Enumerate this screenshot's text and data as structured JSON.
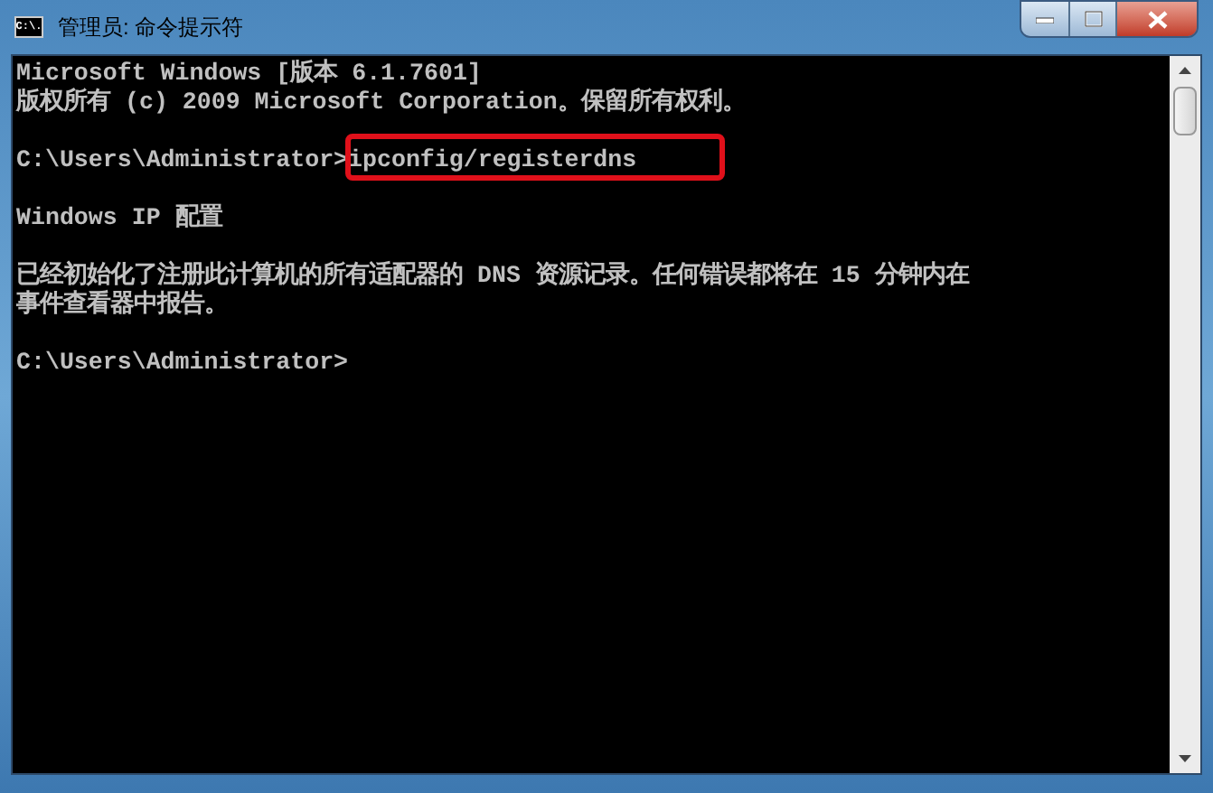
{
  "window": {
    "title": "管理员: 命令提示符",
    "icon_text": "C:\\."
  },
  "console": {
    "lines": [
      {
        "kind": "text",
        "text": "Microsoft Windows [版本 6.1.7601]"
      },
      {
        "kind": "text",
        "text": "版权所有 (c) 2009 Microsoft Corporation。保留所有权利。"
      },
      {
        "kind": "blank"
      },
      {
        "kind": "prompt",
        "prompt": "C:\\Users\\Administrator>",
        "command": "ipconfig/registerdns",
        "highlighted": true
      },
      {
        "kind": "blank"
      },
      {
        "kind": "text",
        "text": "Windows IP 配置"
      },
      {
        "kind": "blank"
      },
      {
        "kind": "text",
        "text": "已经初始化了注册此计算机的所有适配器的 DNS 资源记录。任何错误都将在 15 分钟内在"
      },
      {
        "kind": "text",
        "text": "事件查看器中报告。"
      },
      {
        "kind": "blank"
      },
      {
        "kind": "prompt",
        "prompt": "C:\\Users\\Administrator>"
      }
    ]
  }
}
